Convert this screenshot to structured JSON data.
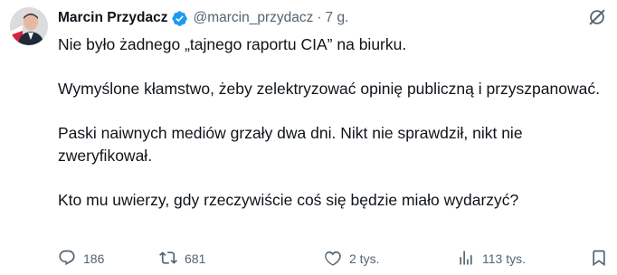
{
  "tweet": {
    "author_name": "Marcin Przydacz",
    "handle": "@marcin_przydacz",
    "separator": "·",
    "time_ago": "7 g.",
    "paragraphs": [
      "Nie było żadnego „tajnego raportu CIA” na biurku.",
      "Wymyślone kłamstwo, żeby zelektryzować opinię publiczną i przyszpanować.",
      "Paski naiwnych mediów grzały dwa dni. Nikt nie sprawdził, nikt nie zweryfikował.",
      "Kto mu uwierzy, gdy rzeczywiście coś się będzie miało wydarzyć?"
    ]
  },
  "actions": {
    "replies": "186",
    "reposts": "681",
    "likes": "2 tys.",
    "views": "113 tys."
  },
  "colors": {
    "text": "#0f1419",
    "secondary": "#536471",
    "verified": "#1d9bf0"
  },
  "icons": [
    "verified-badge-icon",
    "grok-icon",
    "reply-icon",
    "repost-icon",
    "like-icon",
    "views-icon",
    "bookmark-icon"
  ]
}
